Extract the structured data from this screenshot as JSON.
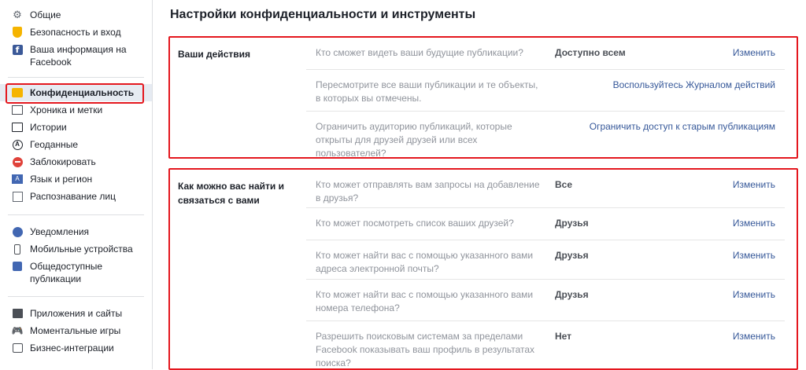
{
  "sidebar": {
    "items": [
      {
        "label": "Общие",
        "icon": "gear-icon"
      },
      {
        "label": "Безопасность и вход",
        "icon": "shield-icon"
      },
      {
        "label": "Ваша информация на Facebook",
        "icon": "facebook-icon"
      },
      {
        "label": "Конфиденциальность",
        "icon": "lock-icon"
      },
      {
        "label": "Хроника и метки",
        "icon": "timeline-icon"
      },
      {
        "label": "Истории",
        "icon": "book-icon"
      },
      {
        "label": "Геоданные",
        "icon": "location-icon"
      },
      {
        "label": "Заблокировать",
        "icon": "block-icon"
      },
      {
        "label": "Язык и регион",
        "icon": "language-icon"
      },
      {
        "label": "Распознавание лиц",
        "icon": "face-icon"
      },
      {
        "label": "Уведомления",
        "icon": "globe-icon"
      },
      {
        "label": "Мобильные устройства",
        "icon": "phone-icon"
      },
      {
        "label": "Общедоступные публикации",
        "icon": "rss-icon"
      },
      {
        "label": "Приложения и сайты",
        "icon": "apps-icon"
      },
      {
        "label": "Моментальные игры",
        "icon": "gamepad-icon"
      },
      {
        "label": "Бизнес-интеграции",
        "icon": "briefcase-icon"
      }
    ]
  },
  "main": {
    "title": "Настройки конфиденциальности и инструменты",
    "sections": [
      {
        "title": "Ваши действия",
        "rows": [
          {
            "question": "Кто сможет видеть ваши будущие публикации?",
            "value": "Доступно всем",
            "action": "Изменить"
          },
          {
            "question": "Пересмотрите все ваши публикации и те объекты, в которых вы отмечены.",
            "value": "",
            "action": "Воспользуйтесь Журналом действий"
          },
          {
            "question": "Ограничить аудиторию публикаций, которые открыты для друзей друзей или всех пользователей?",
            "value": "",
            "action": "Ограничить доступ к старым публикациям"
          }
        ]
      },
      {
        "title": "Как можно вас найти и связаться с вами",
        "rows": [
          {
            "question": "Кто может отправлять вам запросы на добавление в друзья?",
            "value": "Все",
            "action": "Изменить"
          },
          {
            "question": "Кто может посмотреть список ваших друзей?",
            "value": "Друзья",
            "action": "Изменить"
          },
          {
            "question": "Кто может найти вас с помощью указанного вами адреса электронной почты?",
            "value": "Друзья",
            "action": "Изменить"
          },
          {
            "question": "Кто может найти вас с помощью указанного вами номера телефона?",
            "value": "Друзья",
            "action": "Изменить"
          },
          {
            "question": "Разрешить поисковым системам за пределами Facebook показывать ваш профиль в результатах поиска?",
            "value": "Нет",
            "action": "Изменить"
          }
        ]
      }
    ]
  },
  "colors": {
    "link": "#365899",
    "highlight": "#e4171e",
    "active_bg": "#e6ebf2"
  }
}
